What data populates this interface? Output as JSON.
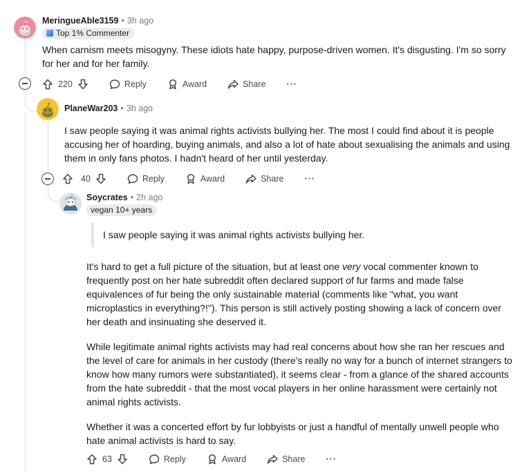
{
  "comments": [
    {
      "author": "MeringueAble3159",
      "time": "3h ago",
      "flair": "Top 1% Commenter",
      "body": [
        "When carnism meets misogyny. These idiots hate happy, purpose-driven women. It's disgusting. I'm so sorry for her and for her family."
      ],
      "score": "220",
      "reply_label": "Reply",
      "award_label": "Award",
      "share_label": "Share",
      "more_label": "···",
      "avatar_color": "#f08a9c"
    },
    {
      "author": "PlaneWar203",
      "time": "3h ago",
      "body": [
        "I saw people saying it was animal rights activists bullying her. The most I could find about it is people accusing her of hoarding, buying animals, and also a lot of hate about sexualising the animals and using them in only fans photos. I hadn't heard of her until yesterday."
      ],
      "score": "40",
      "reply_label": "Reply",
      "award_label": "Award",
      "share_label": "Share",
      "more_label": "···",
      "avatar_color": "#f4c430"
    },
    {
      "author": "Soycrates",
      "time": "2h ago",
      "flair": "vegan 10+ years",
      "quote": "I saw people saying it was animal rights activists bullying her.",
      "p1_before": "It's hard to get a full picture of the situation, but at least one ",
      "p1_em": "very",
      "p1_after": " vocal commenter known to frequently post on her hate subreddit often declared support of fur farms and made false equivalences of fur being the only sustainable material (comments like \"what, you want microplastics in everything?!\"). This person is still actively posting showing a lack of concern over her death and insinuating she deserved it.",
      "p2": "While legitimate animal rights activists may had real concerns about how she ran her rescues and the level of care for animals in her custody (there's really no way for a bunch of internet strangers to know how many rumors were substantiated), it seems clear - from a glance of the shared accounts from the hate subreddit - that the most vocal players in her online harassment were certainly not animal rights activists.",
      "p3": "Whether it was a concerted effort by fur lobbyists or just a handful of mentally unwell people who hate animal activists is hard to say.",
      "score": "63",
      "reply_label": "Reply",
      "award_label": "Award",
      "share_label": "Share",
      "more_label": "···",
      "avatar_color": "#b9c3cc"
    }
  ]
}
